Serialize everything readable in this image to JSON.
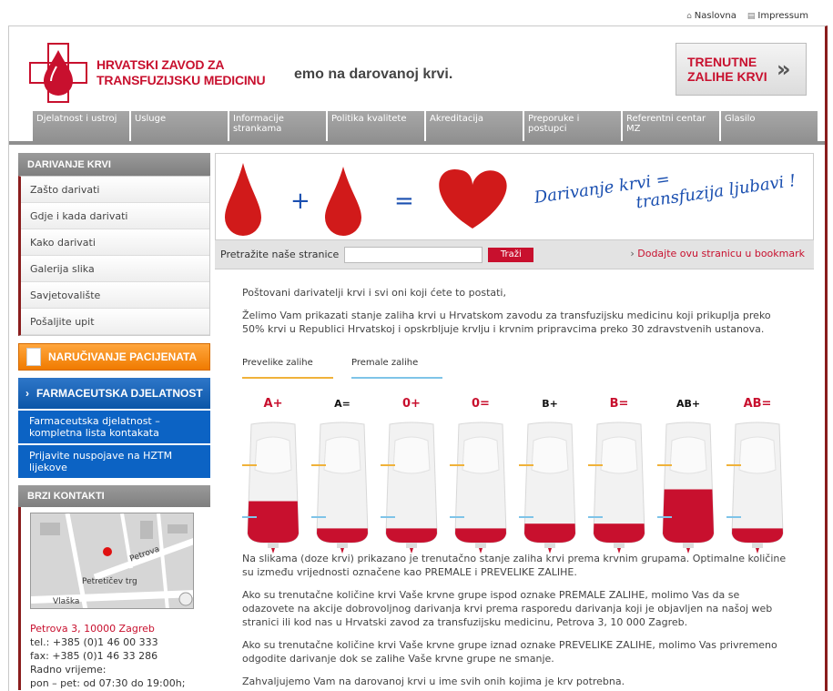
{
  "toplinks": {
    "home": "Naslovna",
    "impressum": "Impressum"
  },
  "header": {
    "logo_line1": "HRVATSKI ZAVOD ZA",
    "logo_line2": "TRANSFUZIJSKU MEDICINU",
    "ticker": "emo na darovanoj krvi.",
    "zalihe_line1": "TRENUTNE",
    "zalihe_line2": "ZALIHE KRVI"
  },
  "nav": [
    "Djelatnost i ustroj",
    "Usluge",
    "Informacije strankama",
    "Politika kvalitete",
    "Akreditacija",
    "Preporuke i postupci",
    "Referentni centar MZ",
    "Glasilo"
  ],
  "sidebar": {
    "heading": "DARIVANJE KRVI",
    "items": [
      "Zašto darivati",
      "Gdje i kada darivati",
      "Kako darivati",
      "Galerija slika",
      "Savjetovalište",
      "Pošaljite upit"
    ],
    "orange": "NARUČIVANJE PACIJENATA",
    "blue_head": "FARMACEUTSKA DJELATNOST",
    "blue_items": [
      "Farmaceutska djelatnost – kompletna lista kontakata",
      "Prijavite nuspojave na HZTM lijekove"
    ],
    "brzi": "BRZI KONTAKTI",
    "map_labels": {
      "street1": "Petrova",
      "street2": "Petretičev trg",
      "street3": "Vlaška"
    },
    "address": "Petrova 3, 10000 Zagreb",
    "tel": "tel.: +385 (0)1 46 00 333",
    "fax": "fax: +385 (0)1 46 33 286",
    "hours_label": "Radno vrijeme:",
    "hours": "pon – pet: od 07:30 do 19:00h;"
  },
  "banner": {
    "slogan1": "Darivanje krvi =",
    "slogan2": "transfuzija ljubavi !"
  },
  "search": {
    "label": "Pretražite naše stranice",
    "button": "Traži",
    "bookmark": "Dodajte ovu stranicu u bookmark"
  },
  "content": {
    "p1": "Poštovani darivatelji krvi i svi oni koji ćete to postati,",
    "p2": "Želimo Vam prikazati stanje zaliha krvi u Hrvatskom zavodu za transfuzijsku medicinu koji prikuplja preko 50% krvi u Republici Hrvatskoj i opskrbljuje krvlju i krvnim pripravcima preko 30 zdravstvenih ustanova.",
    "legend_high": "Prevelike zalihe",
    "legend_low": "Premale zalihe",
    "p3": "Na slikama (doze krvi) prikazano je trenutačno stanje zaliha krvi prema krvnim grupama. Optimalne količine su između vrijednosti označene kao PREMALE i PREVELIKE ZALIHE.",
    "p4": "Ako su trenutačne količine krvi Vaše krvne grupe ispod oznake PREMALE ZALIHE, molimo Vas da se odazovete na akcije dobrovoljnog darivanja krvi prema rasporedu darivanja koji je objavljen na našoj web stranici ili kod nas u Hrvatski zavod za transfuzijsku medicinu, Petrova 3, 10 000 Zagreb.",
    "p5": "Ako su trenutačne količine krvi Vaše krvne grupe iznad oznake PREVELIKE ZALIHE, molimo Vas privremeno odgodite darivanje dok se zalihe Vaše krvne grupe ne smanje.",
    "p6": "Zahvaljujemo Vam na darovanoj krvi u ime svih onih kojima je krv potrebna."
  },
  "colors": {
    "accent_red": "#c8102e",
    "high_mark": "#f0b23a",
    "low_mark": "#7fc4e8",
    "orange": "#f07b00",
    "blue": "#0c63c4"
  },
  "blood_groups": [
    {
      "group": "A+",
      "style": "red",
      "level": 0.35
    },
    {
      "group": "A=",
      "style": "black",
      "level": 0.12
    },
    {
      "group": "0+",
      "style": "red",
      "level": 0.12
    },
    {
      "group": "0=",
      "style": "red",
      "level": 0.12
    },
    {
      "group": "B+",
      "style": "black",
      "level": 0.16
    },
    {
      "group": "B=",
      "style": "red",
      "level": 0.16
    },
    {
      "group": "AB+",
      "style": "black",
      "level": 0.45
    },
    {
      "group": "AB=",
      "style": "red",
      "level": 0.12
    }
  ]
}
